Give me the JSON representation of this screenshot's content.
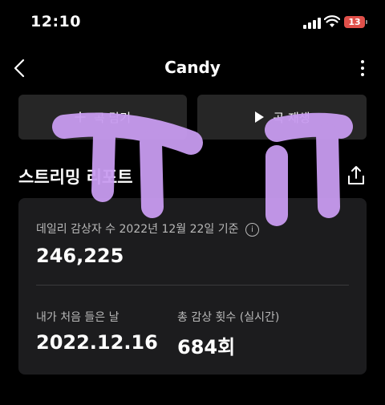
{
  "status_bar": {
    "time": "12:10",
    "battery_level": "13",
    "battery_color": "#e0504a"
  },
  "nav": {
    "title": "Candy"
  },
  "actions": {
    "add_label": "곡 담기",
    "play_label": "곡 재생"
  },
  "report": {
    "section_title": "스트리밍 리포트",
    "daily_listeners_label": "데일리 감상자 수 2022년 12월 22일 기준",
    "daily_listeners_value": "246,225",
    "first_listened_label": "내가 처음 들은 날",
    "first_listened_value": "2022.12.16",
    "total_plays_label": "총 감상 횟수 (실시간)",
    "total_plays_value": "684회"
  },
  "colors": {
    "background": "#000000",
    "card": "#1c1c1e",
    "button": "#262626",
    "overlay_purple": "#c89bf0"
  }
}
